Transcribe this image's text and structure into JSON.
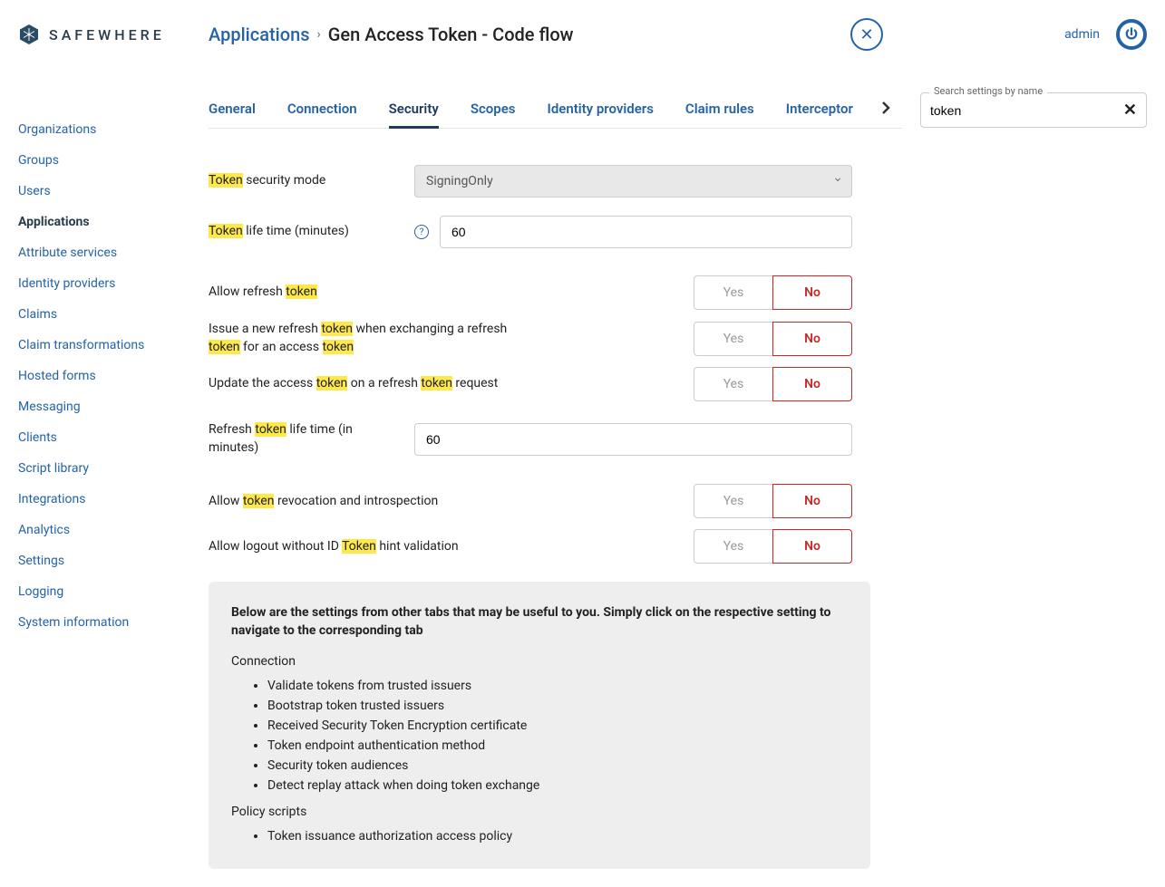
{
  "brand": "SAFEWHERE",
  "breadcrumb": {
    "parent": "Applications",
    "current": "Gen Access Token - Code flow"
  },
  "user": {
    "name": "admin"
  },
  "sidebar": [
    {
      "label": "Organizations",
      "active": false
    },
    {
      "label": "Groups",
      "active": false
    },
    {
      "label": "Users",
      "active": false
    },
    {
      "label": "Applications",
      "active": true
    },
    {
      "label": "Attribute services",
      "active": false
    },
    {
      "label": "Identity providers",
      "active": false
    },
    {
      "label": "Claims",
      "active": false
    },
    {
      "label": "Claim transformations",
      "active": false
    },
    {
      "label": "Hosted forms",
      "active": false
    },
    {
      "label": "Messaging",
      "active": false
    },
    {
      "label": "Clients",
      "active": false
    },
    {
      "label": "Script library",
      "active": false
    },
    {
      "label": "Integrations",
      "active": false
    },
    {
      "label": "Analytics",
      "active": false
    },
    {
      "label": "Settings",
      "active": false
    },
    {
      "label": "Logging",
      "active": false
    },
    {
      "label": "System information",
      "active": false
    }
  ],
  "tabs": [
    {
      "label": "General",
      "active": false
    },
    {
      "label": "Connection",
      "active": false
    },
    {
      "label": "Security",
      "active": true
    },
    {
      "label": "Scopes",
      "active": false
    },
    {
      "label": "Identity providers",
      "active": false
    },
    {
      "label": "Claim rules",
      "active": false
    },
    {
      "label": "Interceptor",
      "active": false
    }
  ],
  "search": {
    "label": "Search settings by name",
    "value": "token"
  },
  "form": {
    "securityMode": {
      "label_pre": "Token",
      "label_post": " security mode",
      "value": "SigningOnly"
    },
    "lifetime": {
      "label_pre": "Token",
      "label_post": " life time (minutes)",
      "value": "60"
    },
    "allowRefresh": {
      "text": "Allow refresh ",
      "hl": "token"
    },
    "issueNew": {
      "t1": "Issue a new refresh ",
      "h1": "token",
      "t2": " when exchanging a refresh ",
      "h2": "token",
      "t3": " for an access ",
      "h3": "token"
    },
    "updateAccess": {
      "t1": "Update the access ",
      "h1": "token",
      "t2": " on a refresh ",
      "h2": "token",
      "t3": " request"
    },
    "refreshLifetime": {
      "t1": "Refresh ",
      "h1": "token",
      "t2": " life time (in minutes)",
      "value": "60"
    },
    "revocation": {
      "t1": "Allow ",
      "h1": "token",
      "t2": " revocation and introspection"
    },
    "logoutHint": {
      "t1": "Allow logout without ID ",
      "h1": "Token",
      "t2": " hint validation"
    },
    "yes": "Yes",
    "no": "No"
  },
  "info": {
    "title": "Below are the settings from other tabs that may be useful to you. Simply click on the respective setting to navigate to the corresponding tab",
    "sections": [
      {
        "title": "Connection",
        "items": [
          "Validate tokens from trusted issuers",
          "Bootstrap token trusted issuers",
          "Received Security Token Encryption certificate",
          "Token endpoint authentication method",
          "Security token audiences",
          "Detect replay attack when doing token exchange"
        ]
      },
      {
        "title": "Policy scripts",
        "items": [
          "Token issuance authorization access policy"
        ]
      }
    ]
  }
}
